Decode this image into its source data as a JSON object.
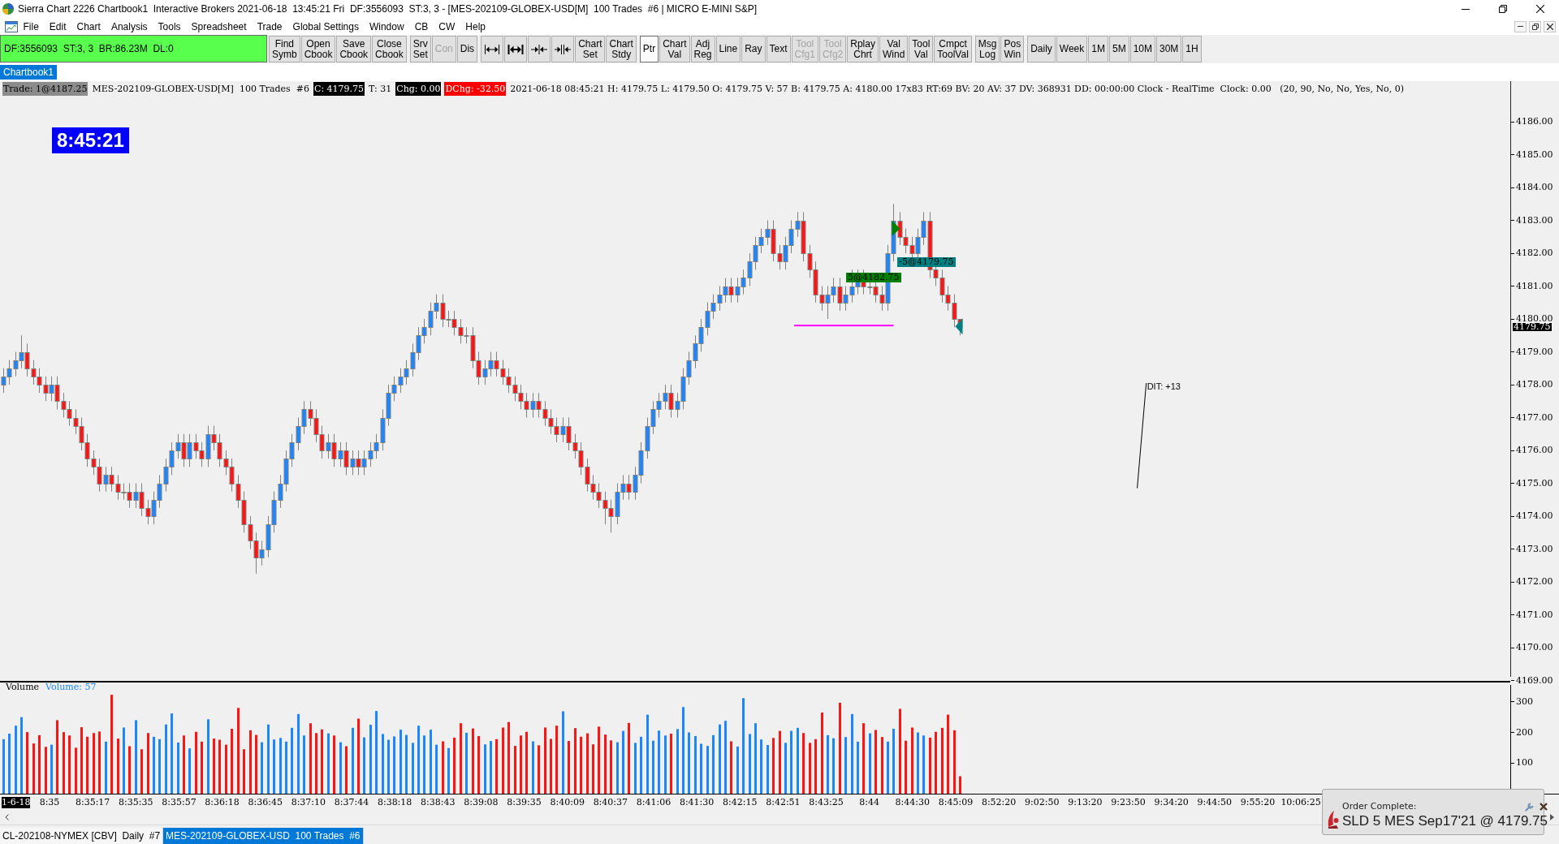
{
  "window": {
    "title": "Sierra Chart 2226 Chartbook1  Interactive Brokers 2021-06-18  13:45:21 Fri  DF:3556093  ST:3, 3 - [MES-202109-GLOBEX-USD[M]  100 Trades  #6 | MICRO E-MINI S&P]"
  },
  "menu": [
    "File",
    "Edit",
    "Chart",
    "Analysis",
    "Tools",
    "Spreadsheet",
    "Trade",
    "Global Settings",
    "Window",
    "CB",
    "CW",
    "Help"
  ],
  "toolbar": {
    "status": "DF:3556093  ST:3, 3  BR:86.23M  DL:0",
    "groups": [
      {
        "buttons": [
          {
            "kind": "text",
            "lines": [
              "Find",
              "Symb"
            ],
            "disabled": false,
            "selected": false
          },
          {
            "kind": "text",
            "lines": [
              "Open",
              "Cbook"
            ],
            "disabled": false,
            "selected": false
          },
          {
            "kind": "text",
            "lines": [
              "Save",
              "Cbook"
            ],
            "disabled": false,
            "selected": false
          },
          {
            "kind": "text",
            "lines": [
              "Close",
              "Cbook"
            ],
            "disabled": false,
            "selected": false
          }
        ]
      },
      {
        "buttons": [
          {
            "kind": "text",
            "lines": [
              "Srv",
              "Set"
            ],
            "disabled": false,
            "selected": false
          },
          {
            "kind": "text",
            "lines": [
              "Con"
            ],
            "disabled": true,
            "selected": false
          },
          {
            "kind": "text",
            "lines": [
              "Dis"
            ],
            "disabled": false,
            "selected": false
          }
        ]
      },
      {
        "buttons": [
          {
            "kind": "icon",
            "disabled": false,
            "selected": false
          },
          {
            "kind": "icon",
            "disabled": false,
            "selected": false
          },
          {
            "kind": "icon",
            "disabled": false,
            "selected": false
          },
          {
            "kind": "icon",
            "disabled": false,
            "selected": false
          },
          {
            "kind": "text",
            "lines": [
              "Chart",
              "Set"
            ],
            "disabled": false,
            "selected": false
          },
          {
            "kind": "text",
            "lines": [
              "Chart",
              "Stdy"
            ],
            "disabled": false,
            "selected": false
          }
        ]
      },
      {
        "buttons": [
          {
            "kind": "text",
            "lines": [
              "Ptr"
            ],
            "disabled": false,
            "selected": true
          },
          {
            "kind": "text",
            "lines": [
              "Chart",
              "Val"
            ],
            "disabled": false,
            "selected": false
          },
          {
            "kind": "text",
            "lines": [
              "Adj",
              "Reg"
            ],
            "disabled": false,
            "selected": false
          },
          {
            "kind": "text",
            "lines": [
              "Line"
            ],
            "disabled": false,
            "selected": false
          },
          {
            "kind": "text",
            "lines": [
              "Ray"
            ],
            "disabled": false,
            "selected": false
          },
          {
            "kind": "text",
            "lines": [
              "Text"
            ],
            "disabled": false,
            "selected": false
          },
          {
            "kind": "text",
            "lines": [
              "Tool",
              "Cfg1"
            ],
            "disabled": true,
            "selected": false
          },
          {
            "kind": "text",
            "lines": [
              "Tool",
              "Cfg2"
            ],
            "disabled": true,
            "selected": false
          },
          {
            "kind": "text",
            "lines": [
              "Rplay",
              "Chrt"
            ],
            "disabled": false,
            "selected": false
          },
          {
            "kind": "text",
            "lines": [
              "Val",
              "Wind"
            ],
            "disabled": false,
            "selected": false
          },
          {
            "kind": "text",
            "lines": [
              "Tool",
              "Val"
            ],
            "disabled": false,
            "selected": false
          },
          {
            "kind": "text",
            "lines": [
              "Cmpct",
              "ToolVal"
            ],
            "disabled": false,
            "selected": false
          }
        ]
      },
      {
        "buttons": [
          {
            "kind": "text",
            "lines": [
              "Msg",
              "Log"
            ],
            "disabled": false,
            "selected": false
          },
          {
            "kind": "text",
            "lines": [
              "Pos",
              "Win"
            ],
            "disabled": false,
            "selected": false
          }
        ]
      },
      {
        "buttons": [
          {
            "kind": "text",
            "lines": [
              "Daily"
            ],
            "disabled": false,
            "selected": false
          },
          {
            "kind": "text",
            "lines": [
              "Week"
            ],
            "disabled": false,
            "selected": false
          },
          {
            "kind": "text",
            "lines": [
              "1M"
            ],
            "disabled": false,
            "selected": false
          },
          {
            "kind": "text",
            "lines": [
              "5M"
            ],
            "disabled": false,
            "selected": false
          },
          {
            "kind": "text",
            "lines": [
              "10M"
            ],
            "disabled": false,
            "selected": false
          },
          {
            "kind": "text",
            "lines": [
              "30M"
            ],
            "disabled": false,
            "selected": false
          },
          {
            "kind": "text",
            "lines": [
              "1H"
            ],
            "disabled": false,
            "selected": false
          }
        ]
      }
    ]
  },
  "chartbook_tabs": [
    {
      "label": "Chartbook1",
      "selected": true
    }
  ],
  "chart": {
    "info_line": [
      {
        "text": "Trade: 1@4187.25",
        "color": "#8c8c8c"
      },
      {
        "text": "MES-202109-GLOBEX-USD[M]  100 Trades  #6"
      },
      {
        "text": "C: 4179.75",
        "color": "#000000"
      },
      {
        "text": "T: 31"
      },
      {
        "text": "Chg: 0.00",
        "color": "#000000"
      },
      {
        "text": "DChg: -32.50",
        "color": "#ff0000"
      },
      {
        "text": "2021-06-18 08:45:21 H: 4179.75 L: 4179.50 O: 4179.75 V: 57 B: 4179.75 A: 4180.00 17x83 RT:69 BV: 20 AV: 37 DV: 368931 DD: 00:00:00 Clock - RealTime  Clock: 0.00   (20, 90, No, No, Yes, No, 0)"
      }
    ],
    "clock": "8:45:21",
    "price_axis": [
      "4186.00",
      "4185.00",
      "4184.00",
      "4183.00",
      "4182.00",
      "4181.00",
      "4180.00",
      "4179.00",
      "4178.00",
      "4177.00",
      "4176.00",
      "4175.00",
      "4174.00",
      "4173.00",
      "4172.00",
      "4171.00",
      "4170.00",
      "4169.00"
    ],
    "last_price": "4179.75",
    "trades": [
      {
        "kind": "buy",
        "label": "5@4182.75",
        "color": "#008000"
      },
      {
        "kind": "sell",
        "label": "-5@4179.75",
        "color": "#008080"
      }
    ],
    "drawings": [
      {
        "kind": "hline",
        "color": "#ff00ff"
      },
      {
        "kind": "line",
        "label": "DIT: +13",
        "color": "#000000"
      }
    ],
    "volume": {
      "legend": "Volume: 57",
      "chart_data": {
        "type": "bar",
        "title": "Volume",
        "stacked": true,
        "ylim": [
          0,
          363
        ],
        "yticks": [
          300,
          200,
          100
        ],
        "categories": [
          null,
          null,
          null,
          null,
          null,
          null,
          null,
          null,
          null,
          null,
          null,
          null,
          null,
          null,
          null,
          null,
          null,
          null,
          null,
          null,
          null,
          null,
          null,
          null,
          null,
          null,
          null,
          null,
          null,
          null,
          null,
          null,
          null,
          null,
          null,
          null,
          null,
          null,
          null,
          null,
          null,
          null,
          null,
          null,
          null,
          null,
          null,
          null,
          null,
          null,
          null,
          null,
          null,
          null,
          null,
          null,
          null,
          null,
          null,
          null,
          null,
          null,
          null,
          null,
          null,
          null,
          null,
          null,
          null,
          null,
          null,
          null,
          null,
          null,
          null,
          null,
          null,
          null,
          null,
          null,
          null,
          null,
          null,
          null,
          null,
          null,
          null,
          null,
          null,
          null,
          null,
          null,
          null,
          null,
          null,
          null,
          null,
          null,
          null,
          null,
          null,
          null,
          null,
          null,
          null,
          null,
          null,
          null,
          null,
          null,
          null,
          null,
          null,
          null,
          null,
          null,
          null,
          null,
          null,
          null,
          null,
          null,
          null,
          null,
          null,
          null,
          null,
          null,
          null,
          null,
          null,
          null,
          null,
          null,
          null,
          null,
          null,
          null,
          null,
          null,
          null,
          null,
          null,
          null,
          null,
          null,
          null,
          null,
          null,
          null,
          null,
          null,
          null,
          null,
          null,
          null,
          null,
          null,
          null,
          null,
          null,
          null,
          null,
          null,
          null,
          null,
          null,
          null,
          null,
          null,
          null,
          null,
          null,
          null,
          null,
          null,
          null,
          null,
          null,
          null,
          null,
          null,
          null,
          null,
          null,
          null,
          null,
          null,
          null,
          null,
          null,
          null,
          null,
          null,
          null,
          null,
          null,
          null,
          null,
          null,
          null,
          null,
          null,
          null,
          null,
          null,
          null,
          null,
          null,
          null,
          null,
          null,
          null,
          null,
          null,
          null,
          null,
          null,
          null,
          null,
          null,
          null,
          null,
          null,
          null,
          null,
          null,
          null,
          null,
          null,
          null,
          null,
          null,
          null,
          null,
          null,
          null,
          null,
          null,
          null,
          null,
          null,
          null,
          null,
          null,
          null,
          null,
          null,
          null,
          null,
          null
        ],
        "series": [
          {
            "color": "#1c86ff",
            "values": [
              178,
              196,
              222,
              250,
              null,
              null,
              null,
              null,
              160,
              null,
              null,
              null,
              null,
              null,
              null,
              null,
              null,
              170,
              null,
              null,
              216,
              null,
              240,
              null,
              null,
              186,
              178,
              226,
              262,
              167,
              null,
              148,
              null,
              null,
              243,
              null,
              null,
              null,
              null,
              null,
              null,
              null,
              null,
              168,
              226,
              177,
              182,
              170,
              215,
              260,
              190,
              null,
              null,
              null,
              197,
              null,
              168,
              null,
              215,
              null,
              184,
              225,
              270,
              195,
              176,
              187,
              209,
              192,
              166,
              222,
              190,
              209,
              160,
              null,
              149,
              null,
              null,
              199,
              null,
              null,
              161,
              172,
              null,
              null,
              null,
              null,
              null,
              null,
              171,
              null,
              null,
              null,
              null,
              269,
              null,
              null,
              null,
              null,
              null,
              null,
              null,
              null,
              168,
              205,
              null,
              166,
              186,
              258,
              173,
              206,
              190,
              null,
              211,
              283,
              200,
              188,
              163,
              156,
              191,
              226,
              238,
              null,
              154,
              312,
              195,
              230,
              177,
              159,
              null,
              null,
              166,
              205,
              215,
              null,
              null,
              null,
              null,
              191,
              181,
              null,
              185,
              260,
              170,
              null,
              197,
              null,
              null,
              170,
              212,
              null,
              null,
              null,
              200,
              190,
              null,
              null,
              null,
              null,
              null,
              null,
              null,
              null,
              null,
              null,
              null,
              null,
              null,
              null,
              null,
              null,
              null,
              null,
              null,
              null,
              null,
              null,
              null,
              null,
              null,
              null,
              null,
              null,
              null,
              null,
              null,
              null,
              null,
              null,
              null,
              null,
              null,
              null,
              null,
              null,
              null,
              null,
              null,
              null,
              null,
              null,
              null,
              null,
              null,
              null,
              null,
              null,
              null,
              null,
              null,
              null,
              null,
              null,
              null,
              null,
              null,
              null,
              null,
              null,
              null,
              null,
              null,
              null,
              null,
              null,
              null,
              null,
              null,
              null,
              null,
              null,
              null,
              null,
              null,
              null,
              null,
              null,
              null,
              null,
              null,
              null,
              null,
              null,
              null,
              null,
              null,
              null,
              null,
              null,
              null,
              null,
              null
            ]
          },
          {
            "color": "#ff1414",
            "values": [
              null,
              null,
              null,
              null,
              201,
              164,
              191,
              153,
              null,
              240,
              201,
              190,
              150,
              217,
              186,
              198,
              203,
              null,
              323,
              180,
              null,
              155,
              null,
              145,
              198,
              null,
              null,
              null,
              null,
              null,
              190,
              null,
              202,
              170,
              null,
              180,
              176,
              160,
              212,
              280,
              145,
              207,
              192,
              null,
              null,
              null,
              null,
              null,
              null,
              null,
              null,
              230,
              198,
              210,
              null,
              190,
              null,
              155,
              null,
              245,
              null,
              null,
              null,
              null,
              null,
              null,
              null,
              null,
              null,
              null,
              null,
              null,
              null,
              171,
              null,
              183,
              230,
              null,
              213,
              188,
              null,
              null,
              178,
              216,
              234,
              156,
              190,
              202,
              null,
              158,
              216,
              179,
              222,
              null,
              172,
              214,
              186,
              197,
              161,
              219,
              193,
              174,
              null,
              null,
              231,
              null,
              null,
              null,
              null,
              null,
              null,
              196,
              null,
              null,
              null,
              null,
              null,
              null,
              null,
              null,
              null,
              171,
              null,
              null,
              null,
              null,
              null,
              null,
              182,
              205,
              null,
              null,
              null,
              198,
              166,
              178,
              265,
              null,
              null,
              297,
              null,
              null,
              null,
              230,
              null,
              208,
              185,
              null,
              null,
              277,
              173,
              216,
              null,
              null,
              183,
              202,
              215,
              258,
              207,
              57,
              null,
              null,
              null,
              null,
              null,
              null,
              null,
              null,
              null,
              null,
              null,
              null,
              null,
              null,
              null,
              null,
              null,
              null,
              null,
              null,
              null,
              null,
              null,
              null,
              null,
              null,
              null,
              null,
              null,
              null,
              null,
              null,
              null,
              null,
              null,
              null,
              null,
              null,
              null,
              null,
              null,
              null,
              null,
              null,
              null,
              null,
              null,
              null,
              null,
              null,
              null,
              null,
              null,
              null,
              null,
              null,
              null,
              null,
              null,
              null,
              null,
              null,
              null,
              null,
              null,
              null,
              null,
              null,
              null,
              null,
              null,
              null,
              null,
              null,
              null,
              null,
              null,
              null,
              null,
              null,
              null,
              null,
              null,
              null,
              null,
              null,
              null,
              null,
              null,
              null,
              null
            ]
          }
        ]
      }
    },
    "time_axis": {
      "date": "1-6-18",
      "times": [
        "8:35",
        "8:35:17",
        "8:35:35",
        "8:35:57",
        "8:36:18",
        "8:36:45",
        "8:37:10",
        "8:37:44",
        "8:38:18",
        "8:38:43",
        "8:39:08",
        "8:39:35",
        "8:40:09",
        "8:40:37",
        "8:41:06",
        "8:41:30",
        "8:42:15",
        "8:42:51",
        "8:43:25",
        "8:44",
        "8:44:30",
        "8:45:09",
        "8:52:20",
        "9:02:50",
        "9:13:20",
        "9:23:50",
        "9:34:20",
        "9:44:50",
        "9:55:20",
        "10:06:25"
      ]
    }
  },
  "chart_tabs": [
    {
      "label": "CL-202108-NYMEX [CBV]  Daily  #7",
      "selected": false
    },
    {
      "label": "MES-202109-GLOBEX-USD  100 Trades  #6",
      "selected": true
    }
  ],
  "notification": {
    "title": "Order Complete:",
    "message": "SLD 5 MES Sep17'21 @ 4179.75"
  }
}
